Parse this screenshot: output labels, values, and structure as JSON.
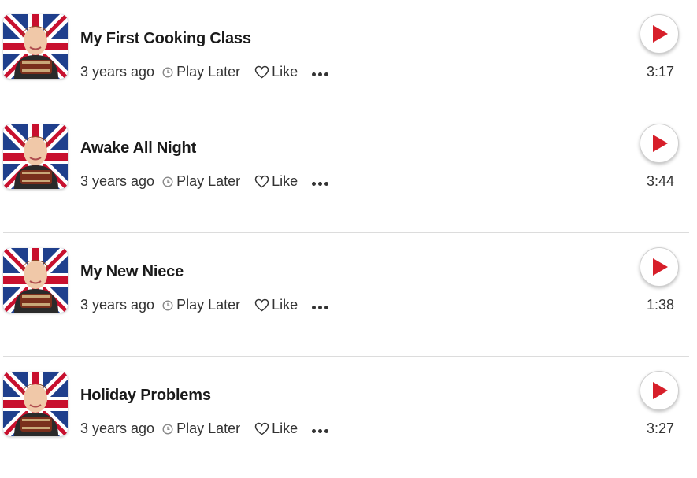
{
  "colors": {
    "accent_red": "#d71f2a",
    "divider": "#dcdcdc",
    "text": "#222222"
  },
  "icons": {
    "thumbnail": "boy-with-union-jack-flag-thumbnail",
    "clock": "clock-icon",
    "heart": "heart-outline-icon",
    "more": "ellipsis-icon",
    "play": "play-triangle-icon"
  },
  "episodes": [
    {
      "title": "My First Cooking Class",
      "age": "3 years ago",
      "play_later": "Play Later",
      "like": "Like",
      "duration": "3:17"
    },
    {
      "title": "Awake All Night",
      "age": "3 years ago",
      "play_later": "Play Later",
      "like": "Like",
      "duration": "3:44"
    },
    {
      "title": "My New Niece",
      "age": "3 years ago",
      "play_later": "Play Later",
      "like": "Like",
      "duration": "1:38"
    },
    {
      "title": "Holiday Problems",
      "age": "3 years ago",
      "play_later": "Play Later",
      "like": "Like",
      "duration": "3:27"
    }
  ]
}
